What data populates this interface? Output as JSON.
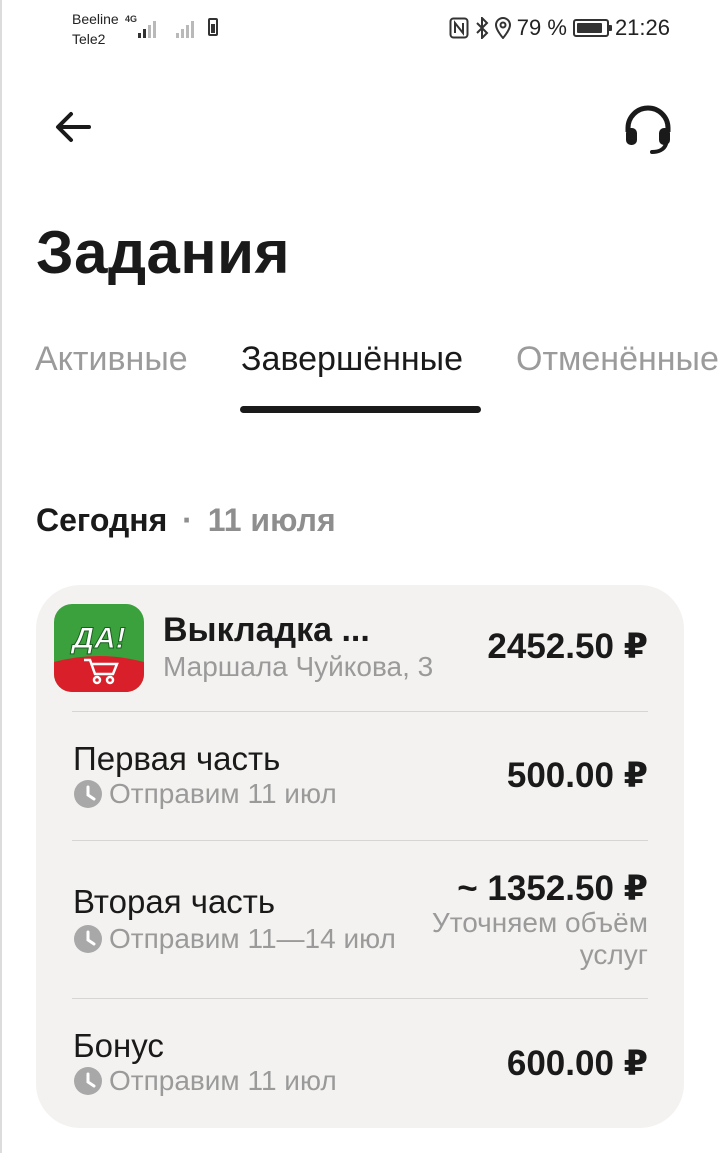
{
  "status_bar": {
    "carrier_1": "Beeline",
    "carrier_2": "Tele2",
    "network_type": "4G",
    "battery_percent": "79 %",
    "time": "21:26",
    "icons": [
      "nfc-icon",
      "bluetooth-icon",
      "location-icon",
      "battery-icon"
    ]
  },
  "header": {
    "back_icon": "arrow-left-icon",
    "support_icon": "headset-icon",
    "title": "Задания"
  },
  "tabs": [
    {
      "label": "Активные",
      "active": false
    },
    {
      "label": "Завершённые",
      "active": true
    },
    {
      "label": "Отменённые",
      "active": false
    }
  ],
  "date_group": {
    "day": "Сегодня",
    "separator": "·",
    "date": "11 июля"
  },
  "task": {
    "logo_text": "ДА!",
    "logo_colors": {
      "green": "#3aa13c",
      "red": "#d9202a"
    },
    "title": "Выкладка ...",
    "address": "Маршала Чуйкова, 3",
    "total": "2452.50 ₽",
    "payments": [
      {
        "label": "Первая часть",
        "schedule": "Отправим 11 июл",
        "amount": "500.00 ₽",
        "note": ""
      },
      {
        "label": "Вторая часть",
        "schedule": "Отправим 11—14 июл",
        "amount": "~ 1352.50 ₽",
        "note": "Уточняем объём услуг"
      },
      {
        "label": "Бонус",
        "schedule": "Отправим 11 июл",
        "amount": "600.00 ₽",
        "note": ""
      }
    ]
  }
}
